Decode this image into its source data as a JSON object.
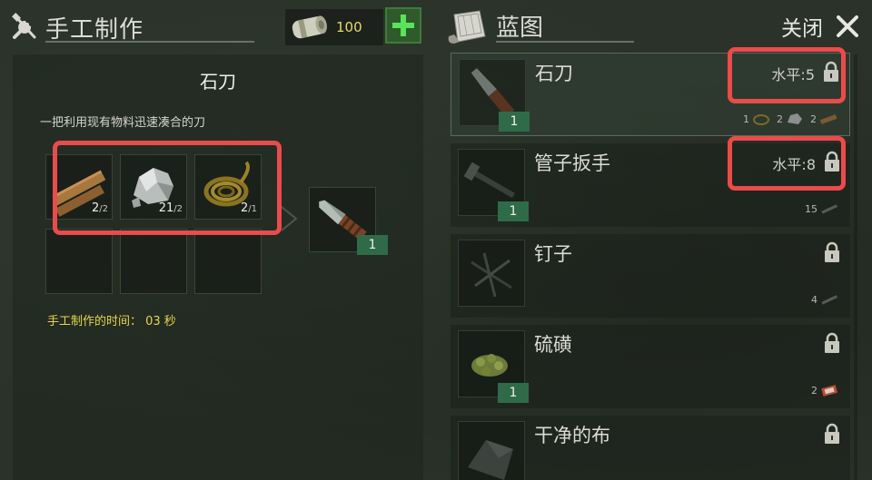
{
  "header": {
    "crafting_title": "手工制作",
    "currency_value": "100",
    "blueprints_title": "蓝图",
    "close_label": "关闭"
  },
  "craft": {
    "item_name": "石刀",
    "description": "一把利用现有物料迅速凑合的刀",
    "ingredients": [
      {
        "icon": "wood-plank-icon",
        "have": "2",
        "need": "/2"
      },
      {
        "icon": "stone-icon",
        "have": "21",
        "need": "/2"
      },
      {
        "icon": "rope-icon",
        "have": "2",
        "need": "/1"
      }
    ],
    "result_count": "1",
    "time_label": "手工制作的时间： 03 秒"
  },
  "blueprints": [
    {
      "name": "石刀",
      "count": "1",
      "level": "水平:5",
      "locked": true,
      "reqs": [
        "1",
        "2",
        "2"
      ],
      "selected": true
    },
    {
      "name": "管子扳手",
      "count": "1",
      "level": "水平:8",
      "locked": true,
      "reqs": [
        "15"
      ],
      "selected": false
    },
    {
      "name": "钉子",
      "count": "",
      "level": "",
      "locked": true,
      "reqs": [
        "4"
      ],
      "selected": false
    },
    {
      "name": "硫磺",
      "count": "1",
      "level": "",
      "locked": true,
      "reqs": [
        "2"
      ],
      "selected": false
    },
    {
      "name": "干净的布",
      "count": "",
      "level": "",
      "locked": true,
      "reqs": [],
      "selected": false
    }
  ],
  "colors": {
    "highlight": "#ea4b4b",
    "count_badge": "#2f6b48",
    "time_text": "#e6d84a",
    "currency_text": "#e9d96a",
    "plus_button": "#2f5a2c"
  }
}
